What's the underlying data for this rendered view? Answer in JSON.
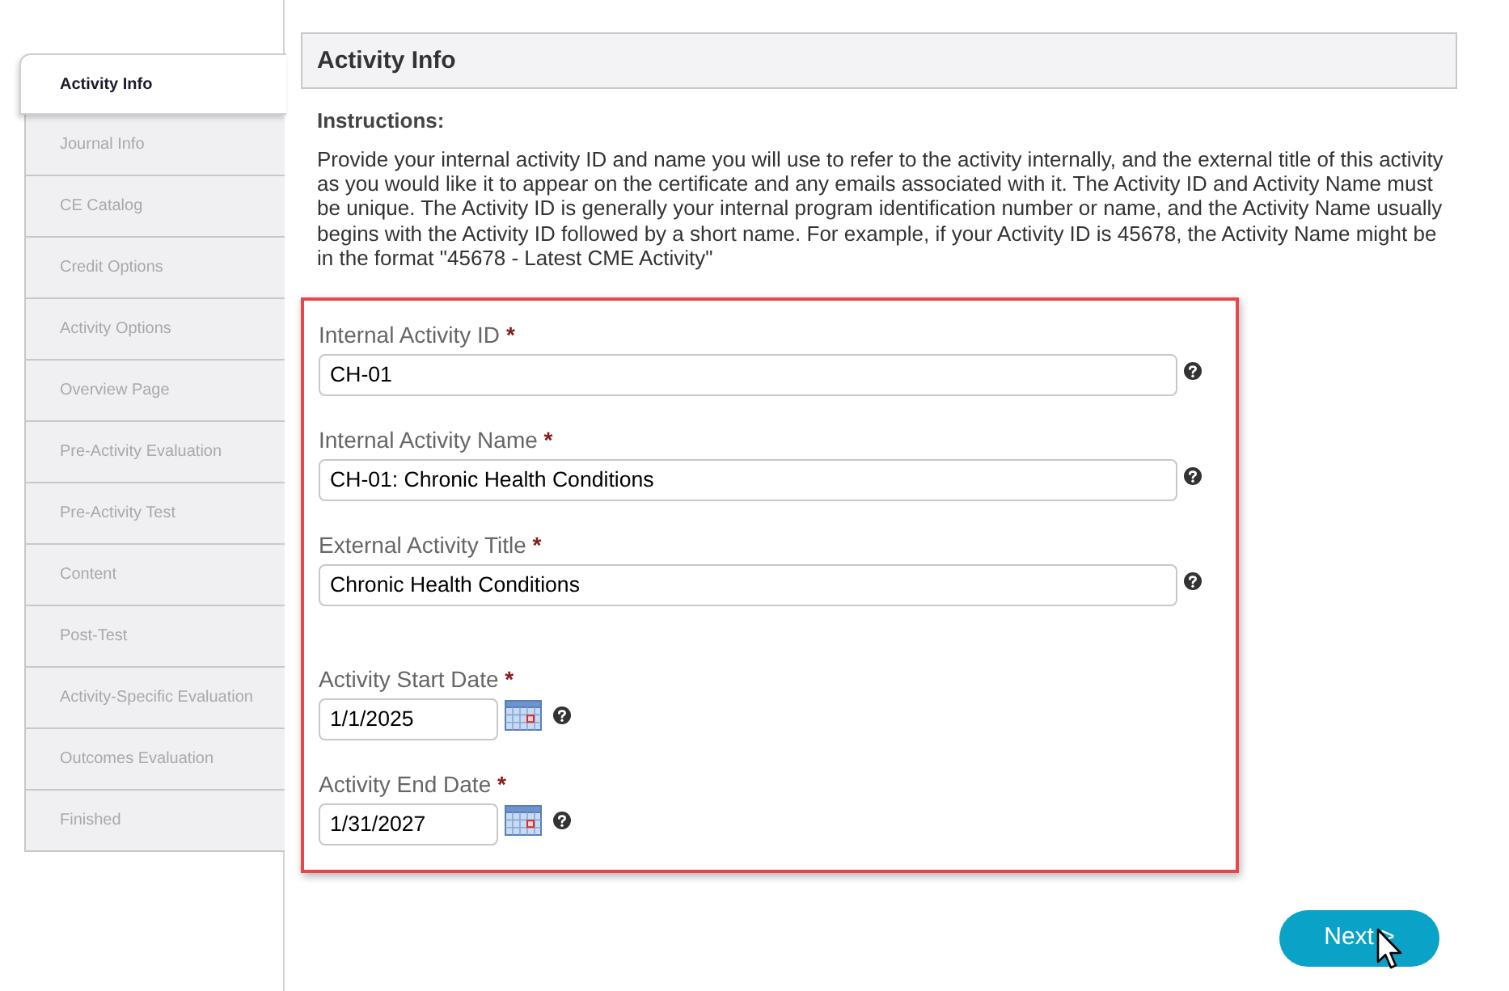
{
  "tabs": [
    {
      "label": "Activity Info",
      "selected": true
    },
    {
      "label": "Journal Info",
      "selected": false
    },
    {
      "label": "CE Catalog",
      "selected": false
    },
    {
      "label": "Credit Options",
      "selected": false
    },
    {
      "label": "Activity Options",
      "selected": false
    },
    {
      "label": "Overview Page",
      "selected": false
    },
    {
      "label": "Pre-Activity Evaluation",
      "selected": false
    },
    {
      "label": "Pre-Activity Test",
      "selected": false
    },
    {
      "label": "Content",
      "selected": false
    },
    {
      "label": "Post-Test",
      "selected": false
    },
    {
      "label": "Activity-Specific Evaluation",
      "selected": false
    },
    {
      "label": "Outcomes Evaluation",
      "selected": false
    },
    {
      "label": "Finished",
      "selected": false
    }
  ],
  "panel": {
    "title": "Activity Info"
  },
  "instructions": {
    "heading": "Instructions:",
    "text": "Provide your internal activity ID and name you will use to refer to the activity internally, and the external title of this activity as you would like it to appear on the certificate and any emails associated with it. The Activity ID and Activity Name must be unique. The Activity ID is generally your internal program identification number or name, and the Activity Name usually begins with the Activity ID followed by a short name. For example, if your Activity ID is 45678, the Activity Name might be in the format \"45678 - Latest CME Activity\""
  },
  "form": {
    "fields": [
      {
        "kind": "text",
        "label": "Internal Activity ID",
        "required_mark": "*",
        "value": "CH-01"
      },
      {
        "kind": "text",
        "label": "Internal Activity Name",
        "required_mark": "*",
        "value": "CH-01: Chronic Health Conditions"
      },
      {
        "kind": "text",
        "label": "External Activity Title",
        "required_mark": "*",
        "value": "Chronic Health Conditions"
      },
      {
        "kind": "date",
        "label": "Activity Start Date",
        "required_mark": "*",
        "value": "1/1/2025"
      },
      {
        "kind": "date",
        "label": "Activity End Date",
        "required_mark": "*",
        "value": "1/31/2027"
      }
    ]
  },
  "next_button": {
    "label": "Next >"
  }
}
